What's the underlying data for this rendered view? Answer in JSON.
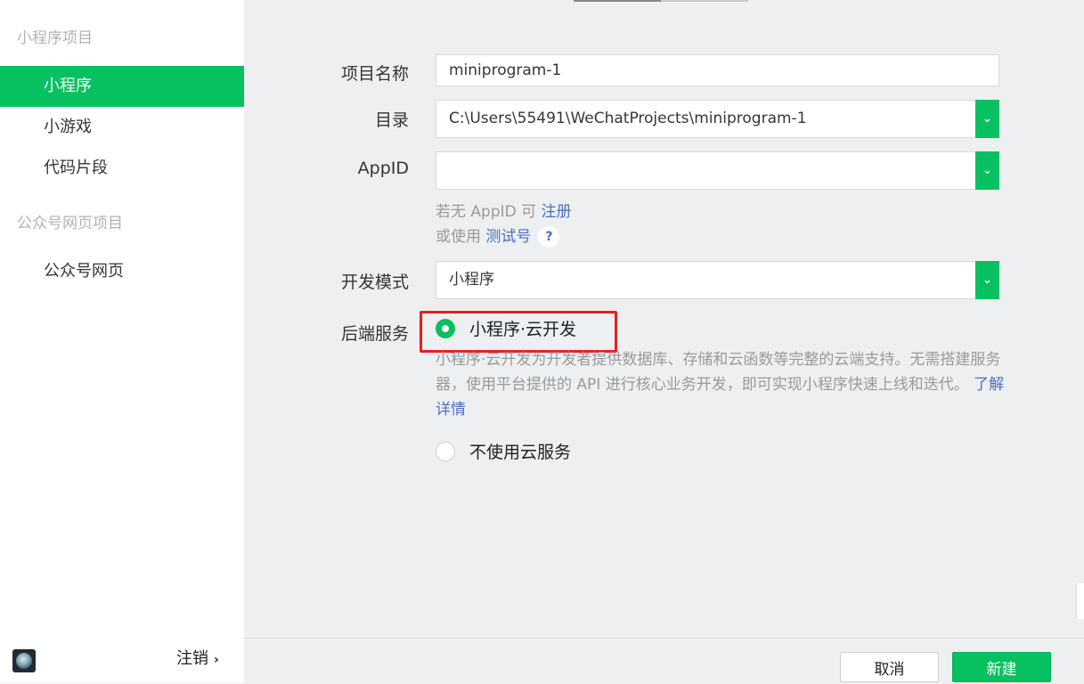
{
  "sidebar": {
    "groups": [
      {
        "label": "小程序项目"
      },
      {
        "label": "公众号网页项目"
      }
    ],
    "items": [
      {
        "label": "小程序",
        "active": true
      },
      {
        "label": "小游戏"
      },
      {
        "label": "代码片段"
      },
      {
        "label": "公众号网页"
      }
    ],
    "footer": {
      "logout_label": "注销",
      "chevron": "›"
    }
  },
  "form": {
    "project_name": {
      "label": "项目名称",
      "value": "miniprogram-1"
    },
    "directory": {
      "label": "目录",
      "value": "C:\\Users\\55491\\WeChatProjects\\miniprogram-1"
    },
    "appid": {
      "label": "AppID",
      "value": "",
      "hint_prefix": "若无 AppID 可",
      "hint_link": "注册",
      "hint2_prefix": "或使用",
      "hint2_link": "测试号",
      "help_icon": "?"
    },
    "dev_mode": {
      "label": "开发模式",
      "value": "小程序"
    },
    "backend": {
      "label": "后端服务",
      "option_cloud": "小程序·云开发",
      "description": "小程序·云开发为开发者提供数据库、存储和云函数等完整的云端支持。无需搭建服务器，使用平台提供的 API 进行核心业务开发，即可实现小程序快速上线和迭代。",
      "learn_more": "了解详情",
      "option_none": "不使用云服务"
    }
  },
  "buttons": {
    "cancel": "取消",
    "create": "新建"
  },
  "colors": {
    "accent": "#07c160",
    "highlight": "#e61f1f",
    "link": "#4a6fc4"
  }
}
